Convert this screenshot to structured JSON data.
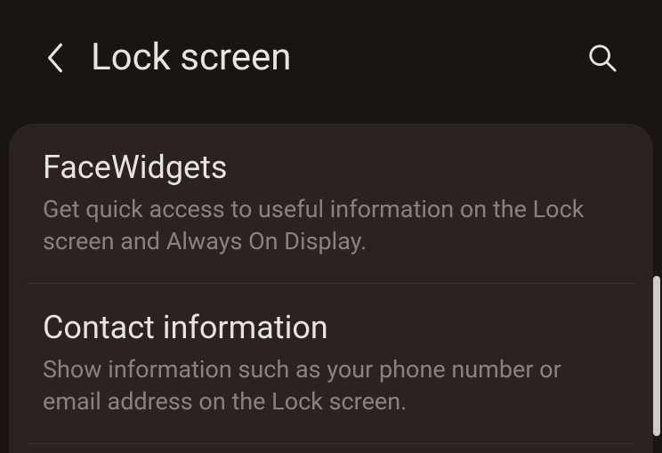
{
  "header": {
    "title": "Lock screen"
  },
  "items": [
    {
      "title": "FaceWidgets",
      "desc": "Get quick access to useful information on the Lock screen and Always On Display."
    },
    {
      "title": "Contact information",
      "desc": "Show information such as your phone number or email address on the Lock screen."
    }
  ]
}
